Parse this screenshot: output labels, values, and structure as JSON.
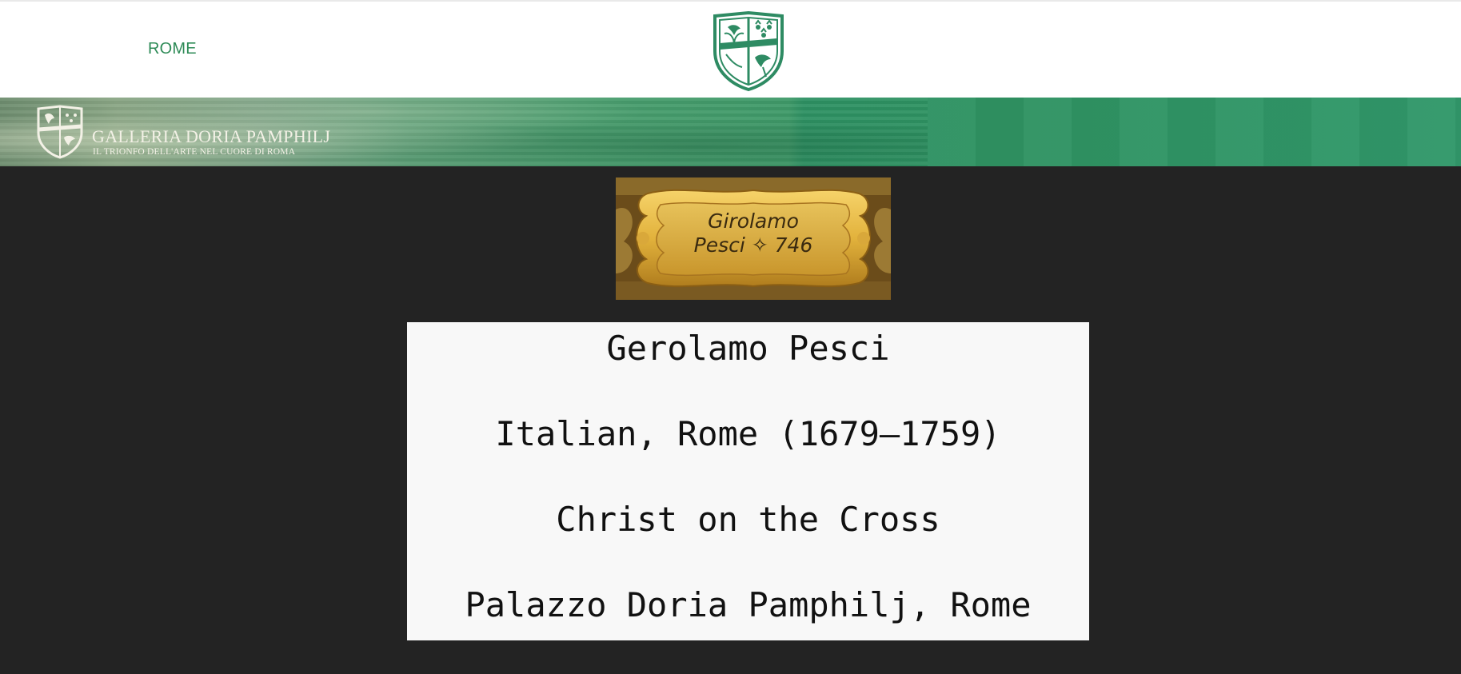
{
  "header": {
    "nav_link": "ROME",
    "crest_icon": "coat-of-arms-icon"
  },
  "banner": {
    "title": "GALLERIA DORIA PAMPHILJ",
    "subtitle": "IL TRIONFO DELL'ARTE NEL CUORE DI ROMA",
    "crest_icon": "coat-of-arms-icon",
    "colors": {
      "banner_green": "#2f9362",
      "text_cream": "#f3f1e6"
    }
  },
  "artwork_plaque": {
    "line1": "Girolamo",
    "line2": "Pesci ✧ 746"
  },
  "label": {
    "artist": "Gerolamo Pesci",
    "origin": "Italian, Rome (1679–1759)",
    "title": "Christ on the Cross",
    "location": "Palazzo Doria Pamphilj, Rome"
  },
  "colors": {
    "nav_link": "#2e8b57",
    "page_background": "#232323",
    "label_background": "#f8f8f8"
  }
}
